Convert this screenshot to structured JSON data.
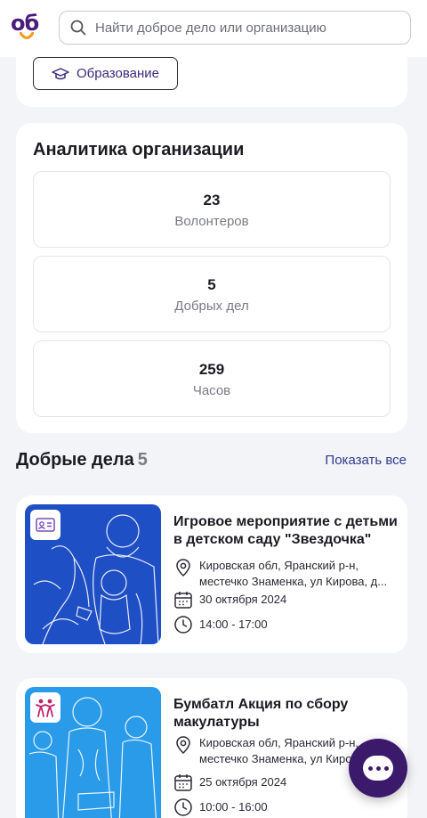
{
  "colors": {
    "brand_purple": "#4b1b7a",
    "logo_smile": "#f59a23",
    "link_blue": "#2e3a8c",
    "card_bg": "#ffffff",
    "page_bg": "#f3f4f8",
    "event1_image": "#1f4fc4",
    "event2_image": "#2a9be8",
    "badge_icon_purple": "#7a4bb8",
    "badge_icon_pink": "#c2246a"
  },
  "header": {
    "logo_text": "об",
    "search": {
      "placeholder": "Найти доброе дело или организацию",
      "value": ""
    }
  },
  "category": {
    "label": "Образование",
    "icon": "graduation-cap-icon"
  },
  "analytics": {
    "title": "Аналитика организации",
    "stats": [
      {
        "value": "23",
        "label": "Волонтеров"
      },
      {
        "value": "5",
        "label": "Добрых дел"
      },
      {
        "value": "259",
        "label": "Часов"
      }
    ]
  },
  "deeds": {
    "title": "Добрые дела",
    "count": "5",
    "show_all": "Показать все",
    "items": [
      {
        "title": "Игровое мероприятие с детьми в детском саду \"Звездочка\"",
        "address": "Кировская обл, Яранский р-н, местечко Знаменка, ул Кирова, д...",
        "date": "30 октября 2024",
        "time": "14:00 - 17:00",
        "badge_icon": "id-card-icon"
      },
      {
        "title": "Бумбатл Акция по сбору макулатуры",
        "address": "Кировская обл, Яранский р-н, местечко Знаменка, ул Кирова",
        "date": "25 октября 2024",
        "time": "10:00 - 16:00",
        "badge_icon": "people-icon"
      }
    ]
  },
  "chat": {
    "icon": "chat-icon"
  }
}
